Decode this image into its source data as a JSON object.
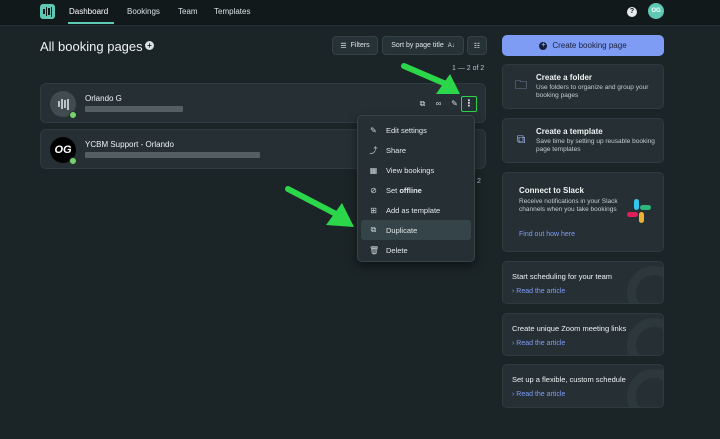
{
  "nav": {
    "links": [
      "Dashboard",
      "Bookings",
      "Team",
      "Templates"
    ],
    "help": "?",
    "user_initials": "OG"
  },
  "header": {
    "title": "All booking pages",
    "filters_label": "Filters",
    "sort_label": "Sort by page title",
    "pagination": "1 — 2 of 2",
    "pagination_partial": "2"
  },
  "cards": [
    {
      "name": "Orlando G"
    },
    {
      "name": "YCBM Support - Orlando",
      "avatar_text": "OG"
    }
  ],
  "menu": {
    "items": [
      {
        "label": "Edit settings",
        "icon": "pencil-icon"
      },
      {
        "label": "Share",
        "icon": "share-icon"
      },
      {
        "label": "View bookings",
        "icon": "calendar-icon"
      },
      {
        "label": "Set ",
        "label_bold": "offline",
        "icon": "offline-icon"
      },
      {
        "label": "Add as template",
        "icon": "template-add-icon"
      },
      {
        "label": "Duplicate",
        "icon": "duplicate-icon",
        "highlighted": true
      },
      {
        "label": "Delete",
        "icon": "trash-icon"
      }
    ]
  },
  "sidebar": {
    "create_label": "Create booking page",
    "folder": {
      "title": "Create a folder",
      "desc": "Use folders to organize and group your booking pages"
    },
    "template": {
      "title": "Create a template",
      "desc": "Save time by setting up reusable booking page templates"
    },
    "slack": {
      "title": "Connect to Slack",
      "desc": "Receive notifications in your Slack channels when you take bookings",
      "link": "Find out how here"
    },
    "articles": [
      {
        "title": "Start scheduling for your team",
        "link": "Read the article"
      },
      {
        "title": "Create unique Zoom meeting links",
        "link": "Read the article"
      },
      {
        "title": "Set up a flexible, custom schedule",
        "link": "Read the article"
      }
    ]
  },
  "colors": {
    "accent": "#5fc9b3",
    "primary_button": "#7f9cf5",
    "annotation_green": "#2bd64a",
    "background": "#1b2427"
  }
}
